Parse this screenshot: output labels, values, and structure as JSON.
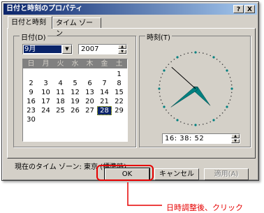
{
  "window": {
    "title": "日付と時刻のプロパティ",
    "help_label": "?",
    "close_label": "X"
  },
  "tabs": [
    {
      "label": "日付と時刻",
      "active": true
    },
    {
      "label": "タイム ゾーン",
      "active": false
    }
  ],
  "date_group": {
    "label": "日付(D)",
    "month_value": "9月",
    "year_value": "2007",
    "calendar": {
      "weekday_headers": [
        "日",
        "月",
        "火",
        "水",
        "木",
        "金",
        "土"
      ],
      "weeks": [
        [
          "",
          "",
          "",
          "",
          "",
          "",
          "1"
        ],
        [
          "2",
          "3",
          "4",
          "5",
          "6",
          "7",
          "8"
        ],
        [
          "9",
          "10",
          "11",
          "12",
          "13",
          "14",
          "15"
        ],
        [
          "16",
          "17",
          "18",
          "19",
          "20",
          "21",
          "22"
        ],
        [
          "23",
          "24",
          "25",
          "26",
          "27",
          "28",
          "29"
        ],
        [
          "30",
          "",
          "",
          "",
          "",
          "",
          ""
        ]
      ],
      "selected_day": "28"
    }
  },
  "time_group": {
    "label": "時刻(T)",
    "time_value": "16: 38: 52",
    "clock": {
      "hour": 16,
      "minute": 38,
      "second": 52
    }
  },
  "timezone_text": "現在のタイム ゾーン: 東京 (標準時)",
  "buttons": {
    "ok": "OK",
    "cancel": "キャンセル",
    "apply": "適用(A)"
  },
  "annotation": {
    "text": "日時調整後、クリック",
    "color": "#e60000"
  },
  "colors": {
    "titlebar": "#0a246a",
    "face": "#d4d0c8",
    "selection": "#0a246a"
  }
}
